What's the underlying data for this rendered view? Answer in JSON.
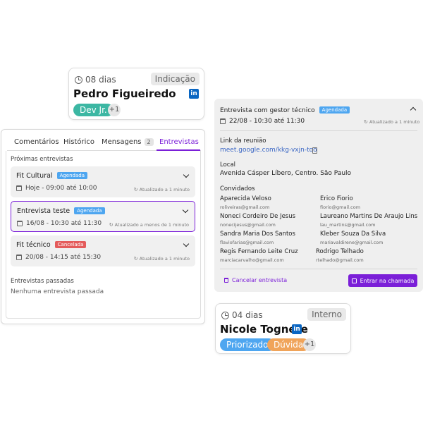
{
  "card1": {
    "days": "08 dias",
    "tag": "Indicação",
    "name": "Pedro Figueiredo",
    "linkedin": "in",
    "pills": [
      {
        "label": "Dev Jr.",
        "color": "#3cb7a3"
      }
    ],
    "extra": "+1"
  },
  "card2": {
    "days": "04 dias",
    "tag": "Interno",
    "name": "Nicole Tognete",
    "linkedin": "in",
    "pills": [
      {
        "label": "Priorizado",
        "color": "#4ea6f0"
      },
      {
        "label": "Dúvida",
        "color": "#f0a45a"
      }
    ],
    "extra": "+1"
  },
  "tabs": [
    {
      "label": "Comentários",
      "active": false
    },
    {
      "label": "Histórico",
      "active": false
    },
    {
      "label": "Mensagens",
      "count": "2",
      "active": false
    },
    {
      "label": "Entrevistas",
      "active": true
    }
  ],
  "upcoming_label": "Próximas entrevistas",
  "interviews": [
    {
      "title": "Fit Cultural",
      "status": "Agendada",
      "status_color": "#4ea6f0",
      "date": "Hoje - 09:00 até 10:00",
      "updated": "Atualizado a 1 minuto",
      "selected": false
    },
    {
      "title": "Entrevista teste",
      "status": "Agendada",
      "status_color": "#4ea6f0",
      "date": "16/08 - 10:30 até 11:30",
      "updated": "Atualizado a menos de 1 minuto",
      "selected": true
    },
    {
      "title": "Fit técnico",
      "status": "Cancelada",
      "status_color": "#e45b5b",
      "date": "20/08 - 14:15 até 15:30",
      "updated": "Atualizado a 1 minuto",
      "selected": false
    }
  ],
  "past_label": "Entrevistas passadas",
  "past_empty": "Nenhuma entrevista passada",
  "detail": {
    "title": "Entrevista com gestor técnico",
    "status": "Agendada",
    "date": "22/08 - 10:30 até 11:30",
    "updated": "Atualizado a 1 minuto",
    "link_label": "Link da reunião",
    "link": "meet.google.com/kkg-vxjn-too",
    "place_label": "Local",
    "place": "Avenida Cásper Líbero, Centro. São Paulo",
    "guests_label": "Convidados",
    "guests": [
      {
        "name": "Aparecida Veloso",
        "email": "roliveiras@gmail.com"
      },
      {
        "name": "Erico Fiorio",
        "email": "fiorio@gmail.com"
      },
      {
        "name": "Noneci Cordeiro De Jesus",
        "email": "nonecijesus@gmail.com"
      },
      {
        "name": "Laureano Martins De Araujo Lins",
        "email": "lau_martins@gmail.com"
      },
      {
        "name": "Sandra Maria Dos Santos",
        "email": "flaviofarias@gmail.com"
      },
      {
        "name": "Kleber Souza Da Silva",
        "email": "mariavaldirene@gmail.com"
      },
      {
        "name": "Regis Fernando Leite Cruz",
        "email": "marciacarvalho@gmail.com"
      },
      {
        "name": "Rodrigo Telhado",
        "email": "rtelhado@gmail.com"
      }
    ],
    "cancel_label": "Cancelar entrevista",
    "enter_label": "Entrar na chamada"
  }
}
